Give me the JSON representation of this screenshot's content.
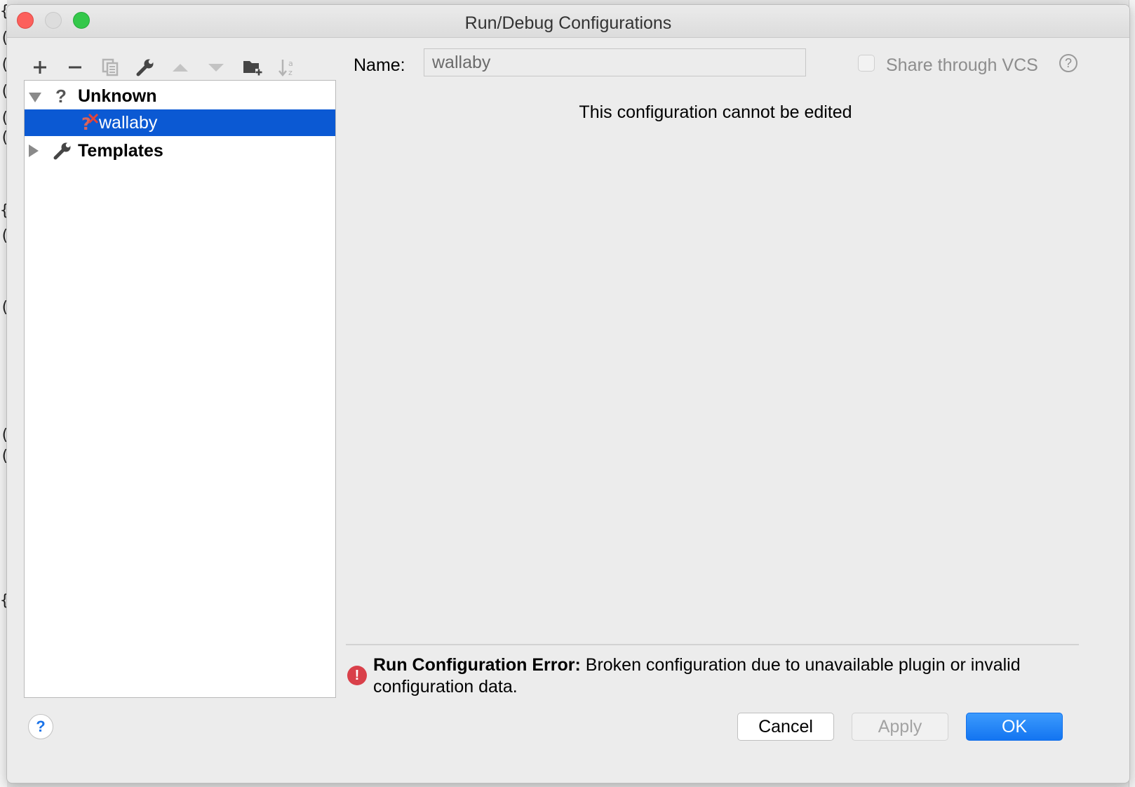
{
  "window": {
    "title": "Run/Debug Configurations"
  },
  "toolbar": {
    "items": [
      {
        "icon": "add-icon",
        "enabled": true
      },
      {
        "icon": "remove-icon",
        "enabled": true
      },
      {
        "icon": "copy-icon",
        "enabled": false
      },
      {
        "icon": "wrench-icon",
        "enabled": true
      },
      {
        "icon": "move-up-icon",
        "enabled": false
      },
      {
        "icon": "move-down-icon",
        "enabled": false
      },
      {
        "icon": "new-folder-icon",
        "enabled": true
      },
      {
        "icon": "sort-alpha-icon",
        "enabled": false
      }
    ]
  },
  "tree": {
    "groups": [
      {
        "label": "Unknown",
        "icon": "question-icon",
        "expanded": true,
        "children": [
          {
            "label": "wallaby",
            "icon": "broken-config-icon",
            "selected": true
          }
        ]
      },
      {
        "label": "Templates",
        "icon": "wrench-icon",
        "expanded": false
      }
    ]
  },
  "form": {
    "name_label": "Name:",
    "name_value": "wallaby",
    "share_label": "Share through VCS",
    "share_checked": false,
    "help_glyph": "?",
    "message": "This configuration cannot be edited"
  },
  "error": {
    "glyph": "!",
    "title": "Run Configuration Error:",
    "message": "Broken configuration due to unavailable plugin or invalid configuration data."
  },
  "footer": {
    "help_glyph": "?",
    "cancel_label": "Cancel",
    "apply_label": "Apply",
    "ok_label": "OK"
  },
  "colors": {
    "selection": "#0b59d3",
    "primary_button": "#1a7cf5",
    "error": "#d9404a"
  }
}
